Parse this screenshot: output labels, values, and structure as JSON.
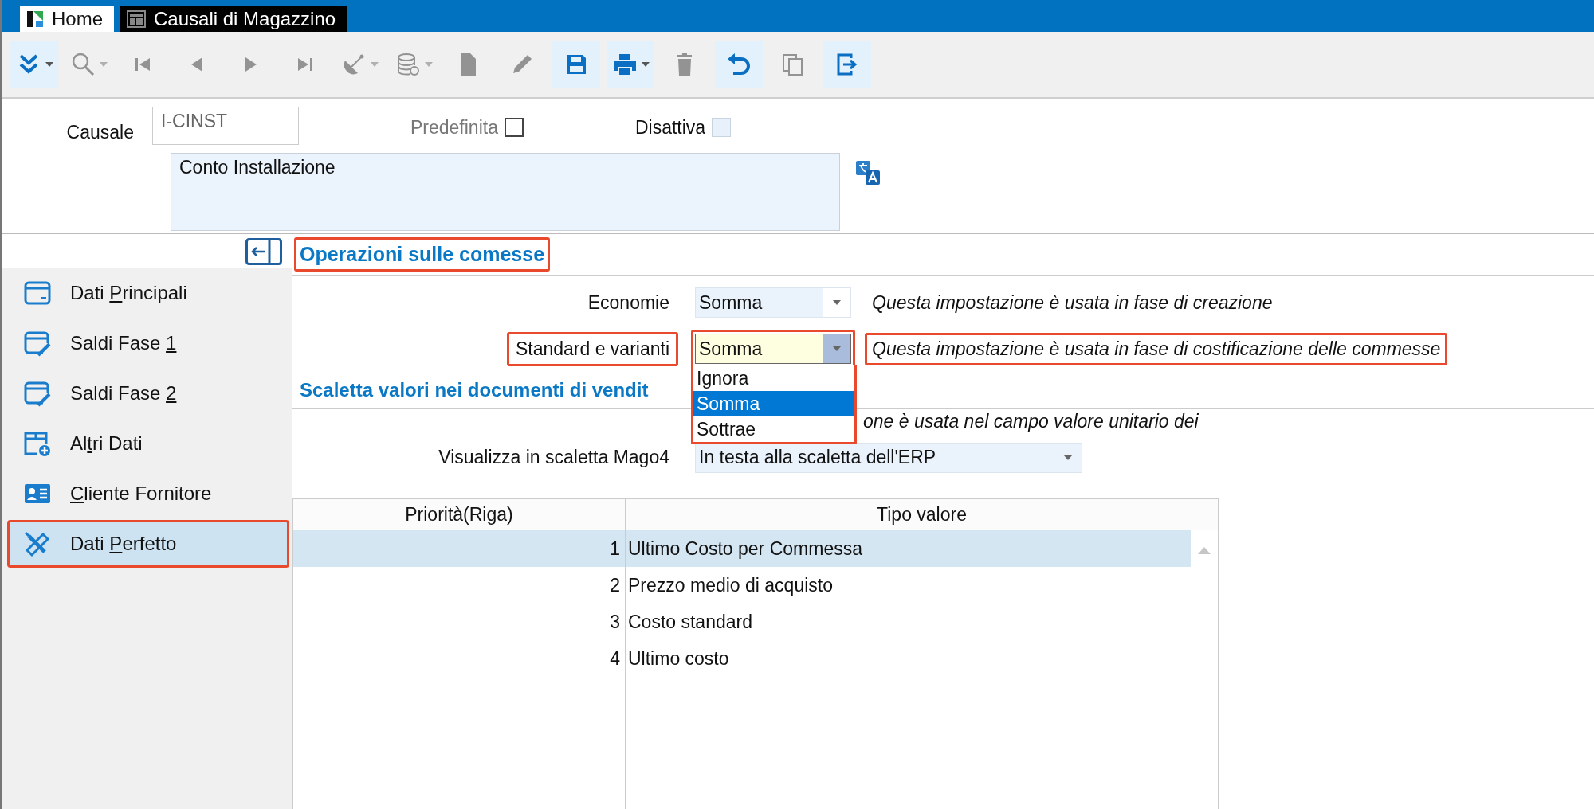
{
  "tabs": [
    {
      "label": "Home",
      "selected": false
    },
    {
      "label": "Causali di Magazzino",
      "selected": true
    }
  ],
  "toolbar": [
    {
      "kind": "expand",
      "enabled": true,
      "dropdown": true,
      "highlighted": true
    },
    {
      "kind": "search",
      "enabled": false,
      "dropdown": true,
      "highlighted": false
    },
    {
      "kind": "first",
      "enabled": false,
      "dropdown": false,
      "highlighted": false
    },
    {
      "kind": "prev",
      "enabled": false,
      "dropdown": false,
      "highlighted": false
    },
    {
      "kind": "next",
      "enabled": false,
      "dropdown": false,
      "highlighted": false
    },
    {
      "kind": "last",
      "enabled": false,
      "dropdown": false,
      "highlighted": false
    },
    {
      "kind": "radar",
      "enabled": false,
      "dropdown": true,
      "highlighted": false
    },
    {
      "kind": "database",
      "enabled": false,
      "dropdown": true,
      "highlighted": false
    },
    {
      "kind": "new",
      "enabled": false,
      "dropdown": false,
      "highlighted": false
    },
    {
      "kind": "edit",
      "enabled": false,
      "dropdown": false,
      "highlighted": false
    },
    {
      "kind": "save",
      "enabled": true,
      "dropdown": false,
      "highlighted": true
    },
    {
      "kind": "print",
      "enabled": true,
      "dropdown": true,
      "highlighted": true
    },
    {
      "kind": "delete",
      "enabled": false,
      "dropdown": false,
      "highlighted": false
    },
    {
      "kind": "undo",
      "enabled": true,
      "dropdown": false,
      "highlighted": true
    },
    {
      "kind": "copy",
      "enabled": false,
      "dropdown": false,
      "highlighted": false
    },
    {
      "kind": "exit",
      "enabled": true,
      "dropdown": false,
      "highlighted": true
    }
  ],
  "header": {
    "code_label": "Causale",
    "code_value": "I-CINST",
    "checkboxes": [
      {
        "label": "Predefinita",
        "checked": false,
        "disabled": true,
        "readonly": false
      },
      {
        "label": "Disattiva",
        "checked": false,
        "disabled": false,
        "readonly": true
      }
    ],
    "description": "Conto Installazione"
  },
  "sidebar": {
    "items": [
      {
        "kind": "window",
        "pre": "Dati ",
        "key": "P",
        "post": "rincipali",
        "selected": false
      },
      {
        "kind": "window-edit",
        "pre": "Saldi Fase ",
        "key": "1",
        "selected": false
      },
      {
        "kind": "window-edit",
        "pre": "Saldi Fase ",
        "key": "2",
        "selected": false
      },
      {
        "kind": "window-add",
        "pre": "Al",
        "key": "t",
        "post": "ri Dati",
        "selected": false
      },
      {
        "kind": "contact",
        "key": "C",
        "post": "liente Fornitore",
        "selected": false
      },
      {
        "kind": "tools",
        "pre": "Dati ",
        "key": "P",
        "post": "erfetto",
        "selected": true
      }
    ]
  },
  "section_1": {
    "title": "Operazioni sulle comesse",
    "highlighted": true,
    "rows": [
      {
        "label": "Economie",
        "value": "Somma",
        "hint": "Questa impostazione è usata in fase di creazione",
        "focused": false,
        "highlighted": false
      },
      {
        "label": "Standard e varianti",
        "value": "Somma",
        "hint": "Questa impostazione è usata in fase di costificazione delle commesse",
        "focused": true,
        "highlighted": true,
        "options": [
          {
            "label": "Ignora",
            "selected": false
          },
          {
            "label": "Somma",
            "selected": true
          },
          {
            "label": "Sottrae",
            "selected": false
          }
        ]
      }
    ]
  },
  "section_2": {
    "title": "Scaletta valori nei documenti di vendit",
    "hint": "one è usata nel campo valore unitario dei",
    "field_label": "Visualizza in scaletta Mago4",
    "field_value": "In testa alla scaletta dell'ERP"
  },
  "table": {
    "columns": [
      "Priorità(Riga)",
      "Tipo valore"
    ],
    "rows": [
      {
        "priority": "1",
        "type": "Ultimo Costo per Commessa",
        "selected": true
      },
      {
        "priority": "2",
        "type": "Prezzo medio di acquisto",
        "selected": false
      },
      {
        "priority": "3",
        "type": "Costo standard",
        "selected": false
      },
      {
        "priority": "4",
        "type": "Ultimo costo",
        "selected": false
      }
    ]
  }
}
